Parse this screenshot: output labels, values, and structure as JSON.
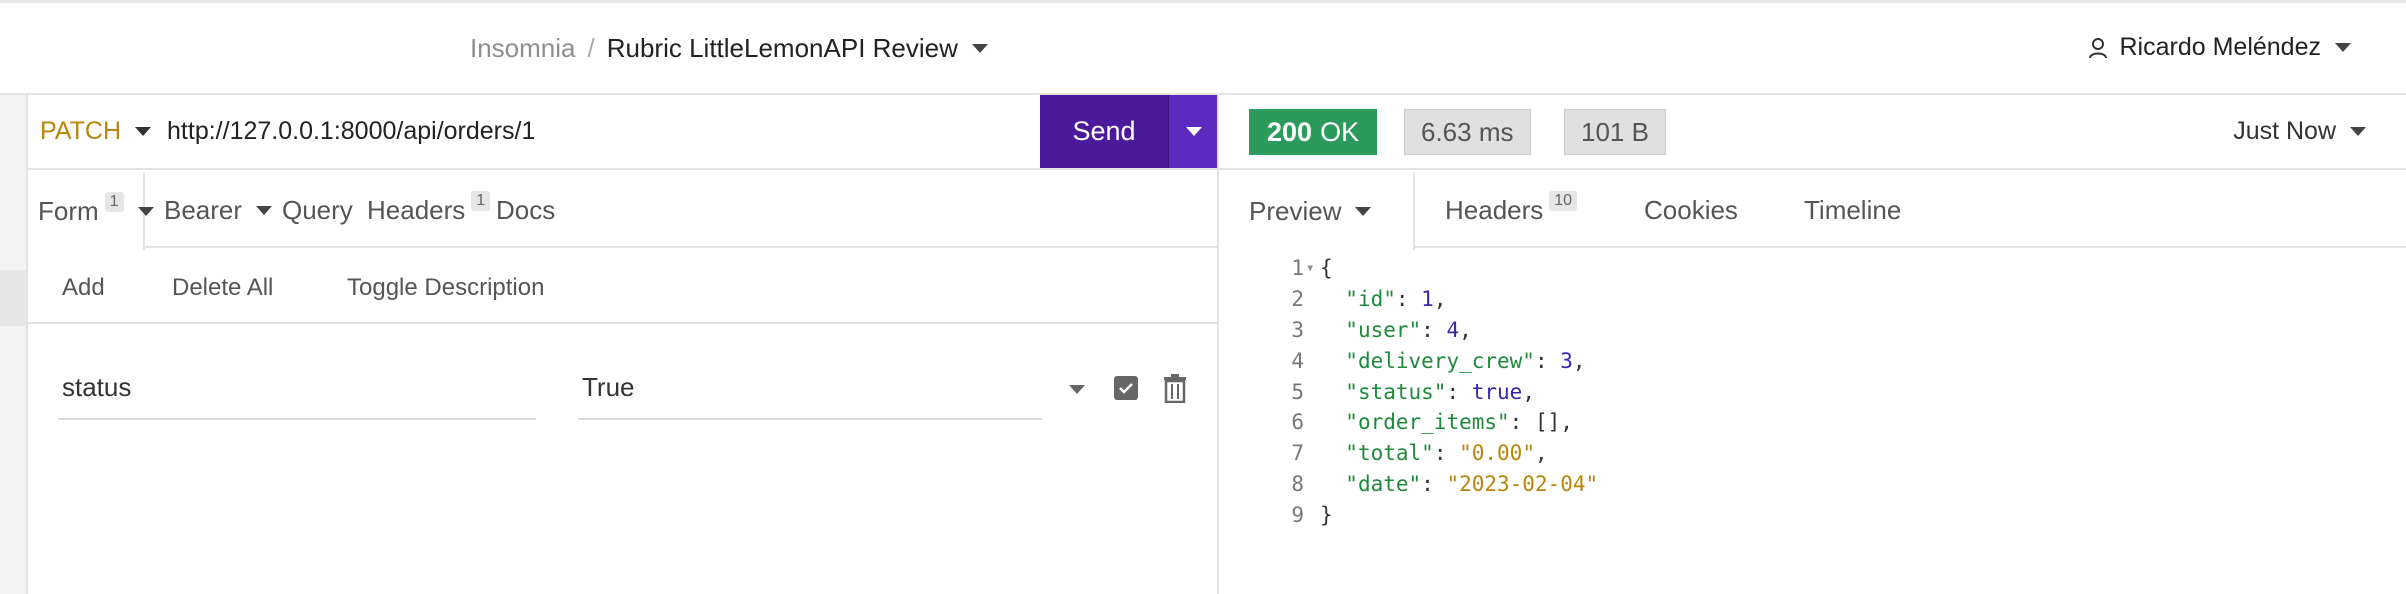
{
  "header": {
    "app_name": "Insomnia",
    "separator": "/",
    "project_name": "Rubric LittleLemonAPI Review",
    "user_name": "Ricardo Meléndez"
  },
  "request": {
    "method": "PATCH",
    "url": "http://127.0.0.1:8000/api/orders/1",
    "send_label": "Send",
    "tabs": [
      {
        "label": "Form",
        "badge": "1"
      },
      {
        "label": "Bearer"
      },
      {
        "label": "Query"
      },
      {
        "label": "Headers",
        "badge": "1"
      },
      {
        "label": "Docs"
      }
    ],
    "toolbar": {
      "add": "Add",
      "delete_all": "Delete All",
      "toggle_description": "Toggle Description"
    },
    "params": [
      {
        "name": "status",
        "value": "True"
      }
    ]
  },
  "response": {
    "status_code": "200",
    "status_text": "OK",
    "time": "6.63 ms",
    "size": "101 B",
    "timestamp": "Just Now",
    "tabs": [
      {
        "label": "Preview"
      },
      {
        "label": "Headers",
        "badge": "10"
      },
      {
        "label": "Cookies"
      },
      {
        "label": "Timeline"
      }
    ],
    "body_lines": [
      {
        "num": "1",
        "key": "",
        "value": "",
        "raw": "{"
      },
      {
        "num": "2",
        "key": "\"id\"",
        "value": "1",
        "vtype": "n",
        "trail": ","
      },
      {
        "num": "3",
        "key": "\"user\"",
        "value": "4",
        "vtype": "n",
        "trail": ","
      },
      {
        "num": "4",
        "key": "\"delivery_crew\"",
        "value": "3",
        "vtype": "n",
        "trail": ","
      },
      {
        "num": "5",
        "key": "\"status\"",
        "value": "true",
        "vtype": "n",
        "trail": ","
      },
      {
        "num": "6",
        "key": "\"order_items\"",
        "value": "[]",
        "vtype": "p",
        "trail": ","
      },
      {
        "num": "7",
        "key": "\"total\"",
        "value": "\"0.00\"",
        "vtype": "s",
        "trail": ","
      },
      {
        "num": "8",
        "key": "\"date\"",
        "value": "\"2023-02-04\"",
        "vtype": "s",
        "trail": ""
      },
      {
        "num": "9",
        "key": "",
        "value": "",
        "raw": "}"
      }
    ]
  },
  "colors": {
    "send_bg": "#4b1a9a",
    "status_ok": "#2c9a5c",
    "method": "#b8860b",
    "json_key": "#1f8a3b",
    "json_number": "#3e25a8",
    "json_string": "#b8860b"
  }
}
